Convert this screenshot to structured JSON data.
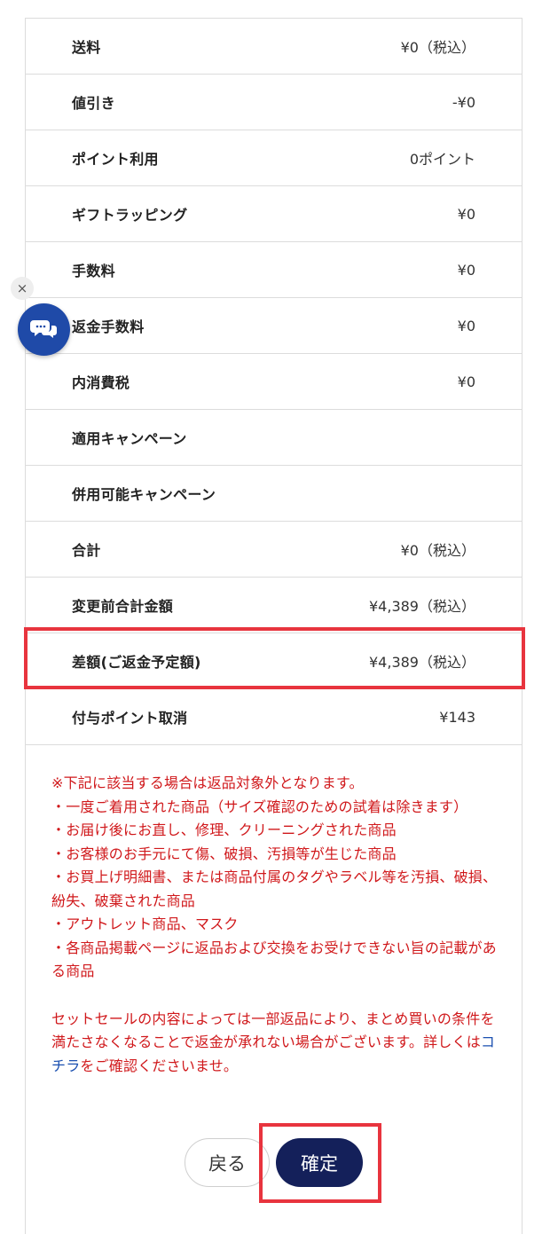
{
  "summary_rows": [
    {
      "label": "送料",
      "value": "¥0（税込）"
    },
    {
      "label": "値引き",
      "value": "-¥0"
    },
    {
      "label": "ポイント利用",
      "value": "0ポイント"
    },
    {
      "label": "ギフトラッピング",
      "value": "¥0"
    },
    {
      "label": "手数料",
      "value": "¥0"
    },
    {
      "label": "返金手数料",
      "value": "¥0"
    },
    {
      "label": "内消費税",
      "value": "¥0"
    },
    {
      "label": "適用キャンペーン",
      "value": ""
    },
    {
      "label": "併用可能キャンペーン",
      "value": ""
    },
    {
      "label": "合計",
      "value": "¥0（税込）"
    },
    {
      "label": "変更前合計金額",
      "value": "¥4,389（税込）"
    },
    {
      "label": "差額(ご返金予定額)",
      "value": "¥4,389（税込）"
    },
    {
      "label": "付与ポイント取消",
      "value": "¥143"
    }
  ],
  "notice": {
    "lines": [
      "※下記に該当する場合は返品対象外となります。",
      "・一度ご着用された商品（サイズ確認のための試着は除きます）",
      "・お届け後にお直し、修理、クリーニングされた商品",
      "・お客様のお手元にて傷、破損、汚損等が生じた商品",
      "・お買上げ明細書、または商品付属のタグやラベル等を汚損、破損、紛失、破棄された商品",
      "・アウトレット商品、マスク",
      "・各商品掲載ページに返品および交換をお受けできない旨の記載がある商品"
    ],
    "set_sale_text": "セットセールの内容によっては一部返品により、まとめ買いの条件を満たさなくなることで返金が承れない場合がございます。詳しくは",
    "link_text": "コチラ",
    "after_link_text": "をご確認くださいませ。"
  },
  "buttons": {
    "back_label": "戻る",
    "confirm_label": "確定"
  },
  "floating": {
    "close_icon": "×",
    "chat_icon": "chat-bubbles-icon"
  },
  "colors": {
    "notice_red": "#d0181b",
    "confirm_navy": "#14205a",
    "chat_blue": "#1f4aa8",
    "highlight_red": "#e8343e",
    "link_blue": "#1a4fb0"
  }
}
